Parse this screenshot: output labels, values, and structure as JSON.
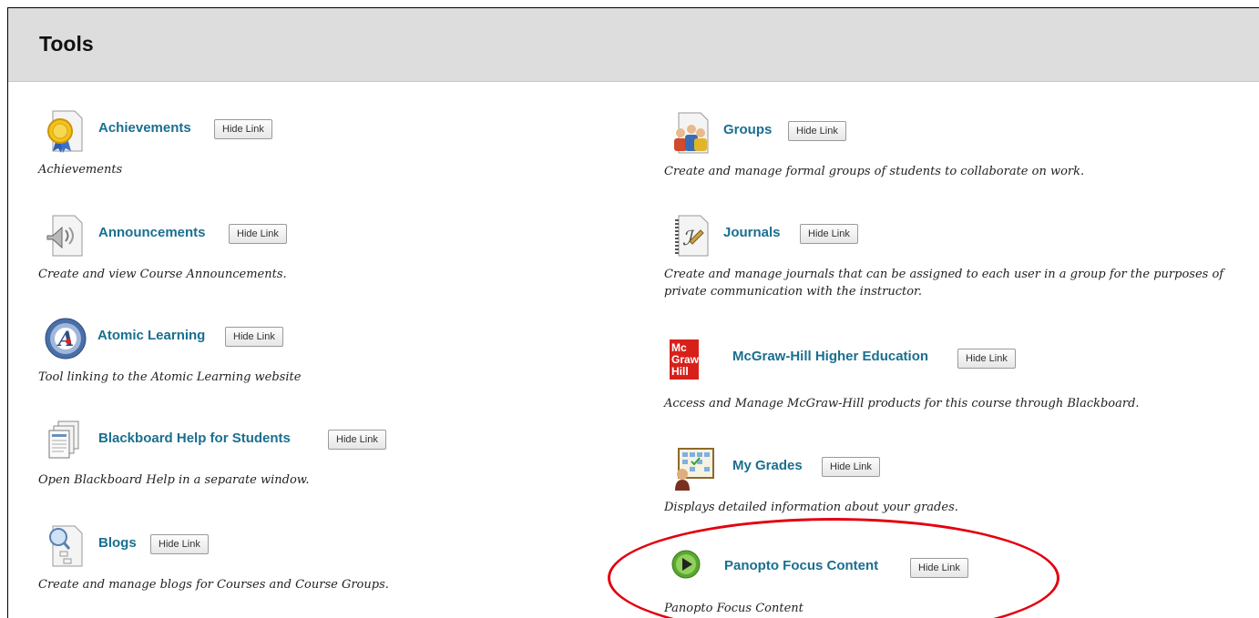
{
  "page": {
    "title": "Tools"
  },
  "hide_link_label": "Hide Link",
  "left_tools": [
    {
      "name": "Achievements",
      "icon": "achievements-ribbon-icon",
      "description": "Achievements"
    },
    {
      "name": "Announcements",
      "icon": "announcements-speaker-icon",
      "description": "Create and view Course Announcements."
    },
    {
      "name": "Atomic Learning",
      "icon": "atomic-learning-icon",
      "description": "Tool linking to the Atomic Learning website"
    },
    {
      "name": "Blackboard Help for Students",
      "icon": "blackboard-help-icon",
      "description": "Open Blackboard Help in a separate window."
    },
    {
      "name": "Blogs",
      "icon": "blogs-icon",
      "description": "Create and manage blogs for Courses and Course Groups."
    }
  ],
  "right_tools": [
    {
      "name": "Groups",
      "icon": "groups-icon",
      "description": "Create and manage formal groups of students to collaborate on work."
    },
    {
      "name": "Journals",
      "icon": "journals-icon",
      "description": "Create and manage journals that can be assigned to each user in a group for the purposes of private communication with the instructor."
    },
    {
      "name": "McGraw-Hill Higher Education",
      "icon": "mcgraw-hill-logo-icon",
      "logo_text": "Mc Graw Hill",
      "description": "Access and Manage McGraw-Hill products for this course through Blackboard."
    },
    {
      "name": "My Grades",
      "icon": "my-grades-icon",
      "description": "Displays detailed information about your grades."
    },
    {
      "name": "Panopto Focus Content",
      "icon": "panopto-play-icon",
      "description": "Panopto Focus Content"
    }
  ],
  "colors": {
    "link": "#1a6f8f",
    "header_bg": "#dddddd",
    "highlight": "#e3000f"
  }
}
